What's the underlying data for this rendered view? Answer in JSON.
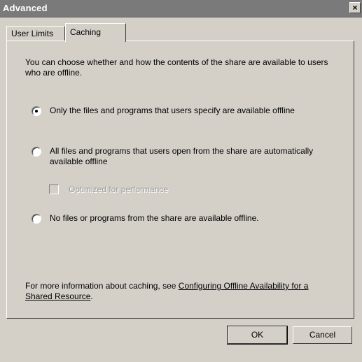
{
  "window": {
    "title": "Advanced",
    "close_glyph": "×"
  },
  "tabs": [
    {
      "label": "User Limits",
      "selected": false
    },
    {
      "label": "Caching",
      "selected": true
    }
  ],
  "caching": {
    "intro": "You can choose whether and how the contents of the share are available to users who are offline.",
    "options": [
      {
        "label": "Only the files and programs that users specify are available offline",
        "selected": true
      },
      {
        "label": "All files and programs that users open from the share are automatically available offline",
        "selected": false
      },
      {
        "label": "No files or programs from the share are available offline.",
        "selected": false
      }
    ],
    "optimized": {
      "label": "Optimized for performance",
      "checked": false,
      "enabled": false
    },
    "more_info_prefix": "For more information about caching, see ",
    "more_info_link": "Configuring Offline Availability for a Shared Resource",
    "more_info_suffix": "."
  },
  "buttons": {
    "ok": "OK",
    "cancel": "Cancel"
  }
}
